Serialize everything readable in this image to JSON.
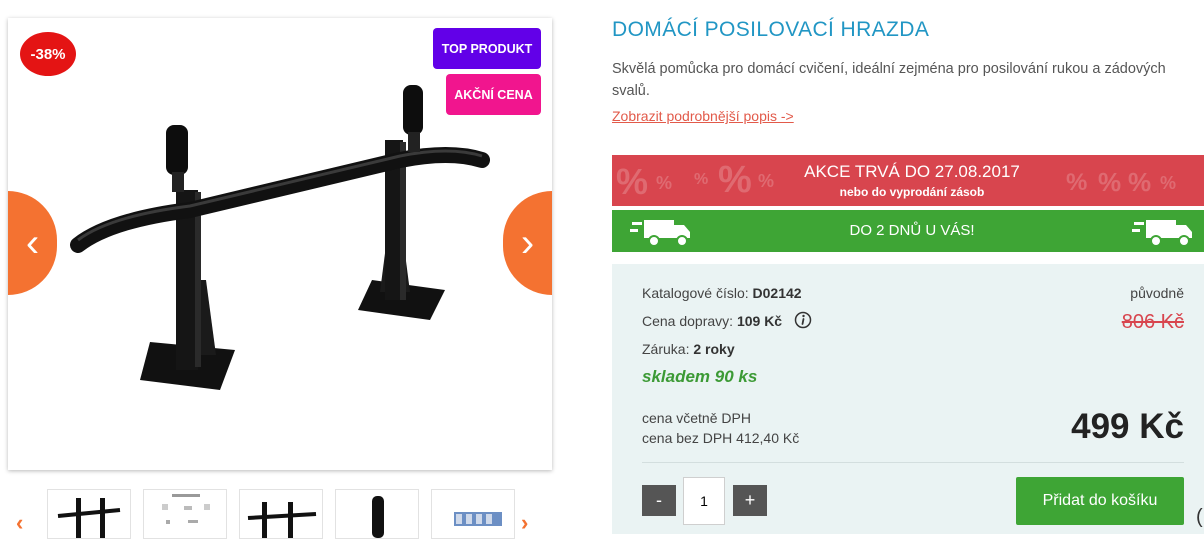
{
  "gallery": {
    "discount_badge": "-38%",
    "badges": [
      "TOP PRODUKT",
      "AKČNÍ CENA"
    ],
    "prev_arrow": "‹",
    "next_arrow": "›",
    "thumb_prev": "‹",
    "thumb_next": "›",
    "thumbnails": [
      "thumb-bar",
      "thumb-manual",
      "thumb-bar-side",
      "thumb-grip",
      "thumb-screws"
    ]
  },
  "product": {
    "title": "DOMÁCÍ POSILOVACÍ HRAZDA",
    "description": "Skvělá pomůcka pro domácí cvičení, ideální zejména pro posilování rukou a zádových svalů.",
    "more_link": "Zobrazit podrobnější popis ->"
  },
  "promo": {
    "title": "AKCE TRVÁ DO 27.08.2017",
    "subtitle": "nebo do vyprodání zásob",
    "color": "#d8454e"
  },
  "delivery": {
    "text": "DO 2 DNŮ U VÁS!",
    "color": "#3ea535"
  },
  "details": {
    "catalog_label": "Katalogové číslo:",
    "catalog_value": "D02142",
    "shipping_label": "Cena dopravy:",
    "shipping_value": "109 Kč",
    "warranty_label": "Záruka:",
    "warranty_value": "2 roky",
    "stock": "skladem 90 ks",
    "vat_incl_label": "cena včetně DPH",
    "vat_excl_label": "cena bez DPH 412,40 Kč"
  },
  "pricing": {
    "original_label": "původně",
    "original_price": "806 Kč",
    "price": "499 Kč"
  },
  "cart": {
    "minus": "-",
    "plus": "+",
    "quantity": "1",
    "add_label": "Přidat do košíku"
  }
}
